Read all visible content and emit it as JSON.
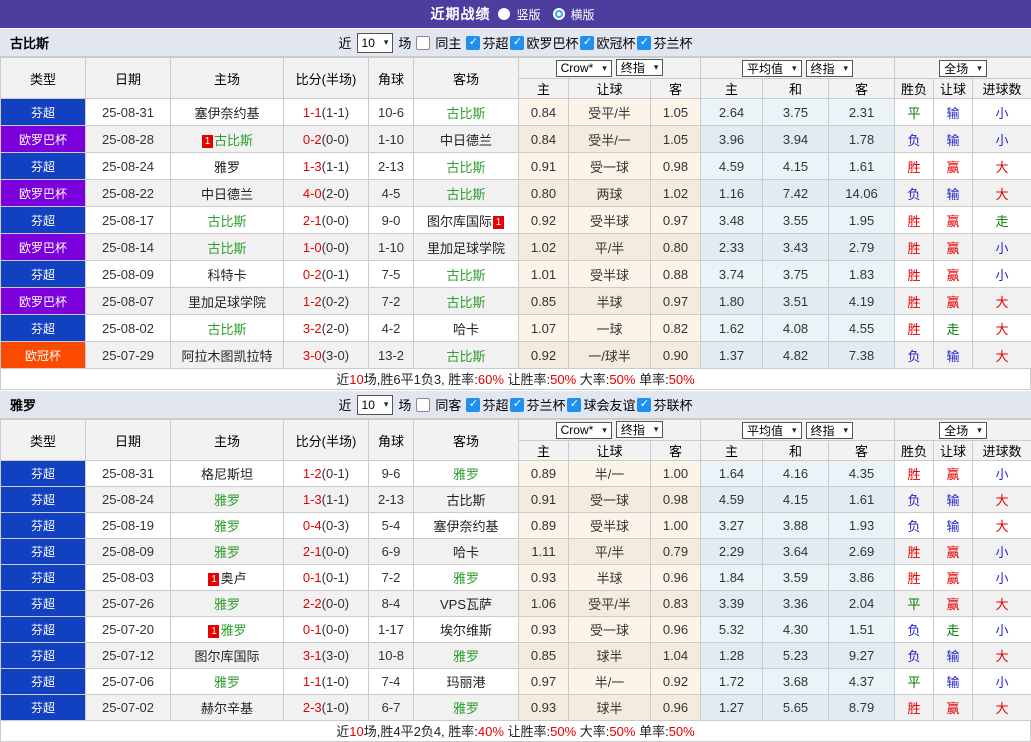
{
  "title_bar": {
    "title": "近期战绩",
    "options": [
      {
        "label": "竖版",
        "selected": false
      },
      {
        "label": "横版",
        "selected": true
      }
    ]
  },
  "icons": {
    "check": "✓",
    "caret": "▾"
  },
  "colors": {
    "title_bg": "#4C3D9E",
    "checkbox_blue": "#2090F0",
    "win_red": "#E60000",
    "loss_blue": "#2323CB",
    "draw_green": "#007D00",
    "focus_team_green": "#2E9E2E",
    "league": {
      "芬超": "#1141C1",
      "欧罗巴杯": "#7B00DC",
      "欧冠杯": "#FA4A00"
    }
  },
  "filter_labels": {
    "near": "近",
    "games": "场"
  },
  "columns": {
    "main": [
      "类型",
      "日期",
      "主场",
      "比分(半场)",
      "角球",
      "客场"
    ],
    "groups": [
      {
        "dropdowns": [
          "Crow*",
          "终指"
        ]
      },
      {
        "dropdowns": [
          "平均值",
          "终指"
        ]
      },
      {
        "dropdowns": [
          "全场"
        ]
      }
    ],
    "sub": [
      "主",
      "让球",
      "客",
      "主",
      "和",
      "客",
      "胜负",
      "让球",
      "进球数"
    ]
  },
  "tables": [
    {
      "team": "古比斯",
      "filter": {
        "count": "10",
        "same_label": "同主",
        "same_checked": false,
        "leagues": [
          {
            "label": "芬超",
            "checked": true
          },
          {
            "label": "欧罗巴杯",
            "checked": true
          },
          {
            "label": "欧冠杯",
            "checked": true
          },
          {
            "label": "芬兰杯",
            "checked": true
          }
        ]
      },
      "rows": [
        {
          "lg": "芬超",
          "date": "25-08-31",
          "home": "塞伊奈约基",
          "ft": "1-1",
          "ht": "(1-1)",
          "ck": "10-6",
          "away": "古比斯",
          "aG": true,
          "odds": [
            "0.84",
            "受平/半",
            "1.05"
          ],
          "avg": [
            "2.64",
            "3.75",
            "2.31"
          ],
          "res": [
            [
              "平",
              "g"
            ],
            [
              "输",
              "b"
            ],
            [
              "小",
              "b"
            ]
          ]
        },
        {
          "lg": "欧罗巴杯",
          "date": "25-08-28",
          "home": "古比斯",
          "hG": true,
          "hB": "1",
          "ft": "0-2",
          "ht": "(0-0)",
          "ck": "1-10",
          "away": "中日德兰",
          "odds": [
            "0.84",
            "受半/一",
            "1.05"
          ],
          "avg": [
            "3.96",
            "3.94",
            "1.78"
          ],
          "res": [
            [
              "负",
              "b"
            ],
            [
              "输",
              "b"
            ],
            [
              "小",
              "b"
            ]
          ]
        },
        {
          "lg": "芬超",
          "date": "25-08-24",
          "home": "雅罗",
          "ft": "1-3",
          "ht": "(1-1)",
          "ck": "2-13",
          "away": "古比斯",
          "aG": true,
          "odds": [
            "0.91",
            "受一球",
            "0.98"
          ],
          "avg": [
            "4.59",
            "4.15",
            "1.61"
          ],
          "res": [
            [
              "胜",
              "r"
            ],
            [
              "赢",
              "r"
            ],
            [
              "大",
              "r"
            ]
          ]
        },
        {
          "lg": "欧罗巴杯",
          "date": "25-08-22",
          "home": "中日德兰",
          "ft": "4-0",
          "ht": "(2-0)",
          "ck": "4-5",
          "away": "古比斯",
          "aG": true,
          "odds": [
            "0.80",
            "两球",
            "1.02"
          ],
          "avg": [
            "1.16",
            "7.42",
            "14.06"
          ],
          "res": [
            [
              "负",
              "b"
            ],
            [
              "输",
              "b"
            ],
            [
              "大",
              "r"
            ]
          ]
        },
        {
          "lg": "芬超",
          "date": "25-08-17",
          "home": "古比斯",
          "hG": true,
          "ft": "2-1",
          "ht": "(0-0)",
          "ck": "9-0",
          "away": "图尔库国际",
          "aB": "1",
          "aBafter": true,
          "odds": [
            "0.92",
            "受半球",
            "0.97"
          ],
          "avg": [
            "3.48",
            "3.55",
            "1.95"
          ],
          "res": [
            [
              "胜",
              "r"
            ],
            [
              "赢",
              "r"
            ],
            [
              "走",
              "g"
            ]
          ]
        },
        {
          "lg": "欧罗巴杯",
          "date": "25-08-14",
          "home": "古比斯",
          "hG": true,
          "ft": "1-0",
          "ht": "(0-0)",
          "ck": "1-10",
          "away": "里加足球学院",
          "odds": [
            "1.02",
            "平/半",
            "0.80"
          ],
          "avg": [
            "2.33",
            "3.43",
            "2.79"
          ],
          "res": [
            [
              "胜",
              "r"
            ],
            [
              "赢",
              "r"
            ],
            [
              "小",
              "b"
            ]
          ]
        },
        {
          "lg": "芬超",
          "date": "25-08-09",
          "home": "科特卡",
          "ft": "0-2",
          "ht": "(0-1)",
          "ck": "7-5",
          "away": "古比斯",
          "aG": true,
          "odds": [
            "1.01",
            "受半球",
            "0.88"
          ],
          "avg": [
            "3.74",
            "3.75",
            "1.83"
          ],
          "res": [
            [
              "胜",
              "r"
            ],
            [
              "赢",
              "r"
            ],
            [
              "小",
              "b"
            ]
          ]
        },
        {
          "lg": "欧罗巴杯",
          "date": "25-08-07",
          "home": "里加足球学院",
          "ft": "1-2",
          "ht": "(0-2)",
          "ck": "7-2",
          "away": "古比斯",
          "aG": true,
          "odds": [
            "0.85",
            "半球",
            "0.97"
          ],
          "avg": [
            "1.80",
            "3.51",
            "4.19"
          ],
          "res": [
            [
              "胜",
              "r"
            ],
            [
              "赢",
              "r"
            ],
            [
              "大",
              "r"
            ]
          ]
        },
        {
          "lg": "芬超",
          "date": "25-08-02",
          "home": "古比斯",
          "hG": true,
          "ft": "3-2",
          "ht": "(2-0)",
          "ck": "4-2",
          "away": "哈卡",
          "odds": [
            "1.07",
            "一球",
            "0.82"
          ],
          "avg": [
            "1.62",
            "4.08",
            "4.55"
          ],
          "res": [
            [
              "胜",
              "r"
            ],
            [
              "走",
              "g"
            ],
            [
              "大",
              "r"
            ]
          ]
        },
        {
          "lg": "欧冠杯",
          "date": "25-07-29",
          "home": "阿拉木图凯拉特",
          "ft": "3-0",
          "ht": "(3-0)",
          "ck": "13-2",
          "away": "古比斯",
          "aG": true,
          "odds": [
            "0.92",
            "一/球半",
            "0.90"
          ],
          "avg": [
            "1.37",
            "4.82",
            "7.38"
          ],
          "res": [
            [
              "负",
              "b"
            ],
            [
              "输",
              "b"
            ],
            [
              "大",
              "r"
            ]
          ]
        }
      ],
      "summary": [
        {
          "t": "近"
        },
        {
          "t": "10",
          "red": true
        },
        {
          "t": "场,胜6平1负3, 胜率:"
        },
        {
          "t": "60%",
          "red": true
        },
        {
          "t": " 让胜率:"
        },
        {
          "t": "50%",
          "red": true
        },
        {
          "t": " 大率:"
        },
        {
          "t": "50%",
          "red": true
        },
        {
          "t": " 单率:"
        },
        {
          "t": "50%",
          "red": true
        }
      ]
    },
    {
      "team": "雅罗",
      "filter": {
        "count": "10",
        "same_label": "同客",
        "same_checked": false,
        "leagues": [
          {
            "label": "芬超",
            "checked": true
          },
          {
            "label": "芬兰杯",
            "checked": true
          },
          {
            "label": "球会友谊",
            "checked": true
          },
          {
            "label": "芬联杯",
            "checked": true
          }
        ]
      },
      "rows": [
        {
          "lg": "芬超",
          "date": "25-08-31",
          "home": "格尼斯坦",
          "ft": "1-2",
          "ht": "(0-1)",
          "ck": "9-6",
          "away": "雅罗",
          "aG": true,
          "odds": [
            "0.89",
            "半/一",
            "1.00"
          ],
          "avg": [
            "1.64",
            "4.16",
            "4.35"
          ],
          "res": [
            [
              "胜",
              "r"
            ],
            [
              "赢",
              "r"
            ],
            [
              "小",
              "b"
            ]
          ]
        },
        {
          "lg": "芬超",
          "date": "25-08-24",
          "home": "雅罗",
          "hG": true,
          "ft": "1-3",
          "ht": "(1-1)",
          "ck": "2-13",
          "away": "古比斯",
          "odds": [
            "0.91",
            "受一球",
            "0.98"
          ],
          "avg": [
            "4.59",
            "4.15",
            "1.61"
          ],
          "res": [
            [
              "负",
              "b"
            ],
            [
              "输",
              "b"
            ],
            [
              "大",
              "r"
            ]
          ]
        },
        {
          "lg": "芬超",
          "date": "25-08-19",
          "home": "雅罗",
          "hG": true,
          "ft": "0-4",
          "ht": "(0-3)",
          "ck": "5-4",
          "away": "塞伊奈约基",
          "odds": [
            "0.89",
            "受半球",
            "1.00"
          ],
          "avg": [
            "3.27",
            "3.88",
            "1.93"
          ],
          "res": [
            [
              "负",
              "b"
            ],
            [
              "输",
              "b"
            ],
            [
              "大",
              "r"
            ]
          ]
        },
        {
          "lg": "芬超",
          "date": "25-08-09",
          "home": "雅罗",
          "hG": true,
          "ft": "2-1",
          "ht": "(0-0)",
          "ck": "6-9",
          "away": "哈卡",
          "odds": [
            "1.11",
            "平/半",
            "0.79"
          ],
          "avg": [
            "2.29",
            "3.64",
            "2.69"
          ],
          "res": [
            [
              "胜",
              "r"
            ],
            [
              "赢",
              "r"
            ],
            [
              "小",
              "b"
            ]
          ]
        },
        {
          "lg": "芬超",
          "date": "25-08-03",
          "home": "奥卢",
          "hB": "1",
          "ft": "0-1",
          "ht": "(0-1)",
          "ck": "7-2",
          "away": "雅罗",
          "aG": true,
          "odds": [
            "0.93",
            "半球",
            "0.96"
          ],
          "avg": [
            "1.84",
            "3.59",
            "3.86"
          ],
          "res": [
            [
              "胜",
              "r"
            ],
            [
              "赢",
              "r"
            ],
            [
              "小",
              "b"
            ]
          ]
        },
        {
          "lg": "芬超",
          "date": "25-07-26",
          "home": "雅罗",
          "hG": true,
          "ft": "2-2",
          "ht": "(0-0)",
          "ck": "8-4",
          "away": "VPS瓦萨",
          "odds": [
            "1.06",
            "受平/半",
            "0.83"
          ],
          "avg": [
            "3.39",
            "3.36",
            "2.04"
          ],
          "res": [
            [
              "平",
              "g"
            ],
            [
              "赢",
              "r"
            ],
            [
              "大",
              "r"
            ]
          ]
        },
        {
          "lg": "芬超",
          "date": "25-07-20",
          "home": "雅罗",
          "hG": true,
          "hB": "1",
          "ft": "0-1",
          "ht": "(0-0)",
          "ck": "1-17",
          "away": "埃尔维斯",
          "odds": [
            "0.93",
            "受一球",
            "0.96"
          ],
          "avg": [
            "5.32",
            "4.30",
            "1.51"
          ],
          "res": [
            [
              "负",
              "b"
            ],
            [
              "走",
              "g"
            ],
            [
              "小",
              "b"
            ]
          ]
        },
        {
          "lg": "芬超",
          "date": "25-07-12",
          "home": "图尔库国际",
          "ft": "3-1",
          "ht": "(3-0)",
          "ck": "10-8",
          "away": "雅罗",
          "aG": true,
          "odds": [
            "0.85",
            "球半",
            "1.04"
          ],
          "avg": [
            "1.28",
            "5.23",
            "9.27"
          ],
          "res": [
            [
              "负",
              "b"
            ],
            [
              "输",
              "b"
            ],
            [
              "大",
              "r"
            ]
          ]
        },
        {
          "lg": "芬超",
          "date": "25-07-06",
          "home": "雅罗",
          "hG": true,
          "ft": "1-1",
          "ht": "(1-0)",
          "ck": "7-4",
          "away": "玛丽港",
          "odds": [
            "0.97",
            "半/一",
            "0.92"
          ],
          "avg": [
            "1.72",
            "3.68",
            "4.37"
          ],
          "res": [
            [
              "平",
              "g"
            ],
            [
              "输",
              "b"
            ],
            [
              "小",
              "b"
            ]
          ]
        },
        {
          "lg": "芬超",
          "date": "25-07-02",
          "home": "赫尔辛基",
          "ft": "2-3",
          "ht": "(1-0)",
          "ck": "6-7",
          "away": "雅罗",
          "aG": true,
          "odds": [
            "0.93",
            "球半",
            "0.96"
          ],
          "avg": [
            "1.27",
            "5.65",
            "8.79"
          ],
          "res": [
            [
              "胜",
              "r"
            ],
            [
              "赢",
              "r"
            ],
            [
              "大",
              "r"
            ]
          ]
        }
      ],
      "summary": [
        {
          "t": "近"
        },
        {
          "t": "10",
          "red": true
        },
        {
          "t": "场,胜4平2负4, 胜率:"
        },
        {
          "t": "40%",
          "red": true
        },
        {
          "t": " 让胜率:"
        },
        {
          "t": "50%",
          "red": true
        },
        {
          "t": " 大率:"
        },
        {
          "t": "50%",
          "red": true
        },
        {
          "t": " 单率:"
        },
        {
          "t": "50%",
          "red": true
        }
      ]
    }
  ]
}
